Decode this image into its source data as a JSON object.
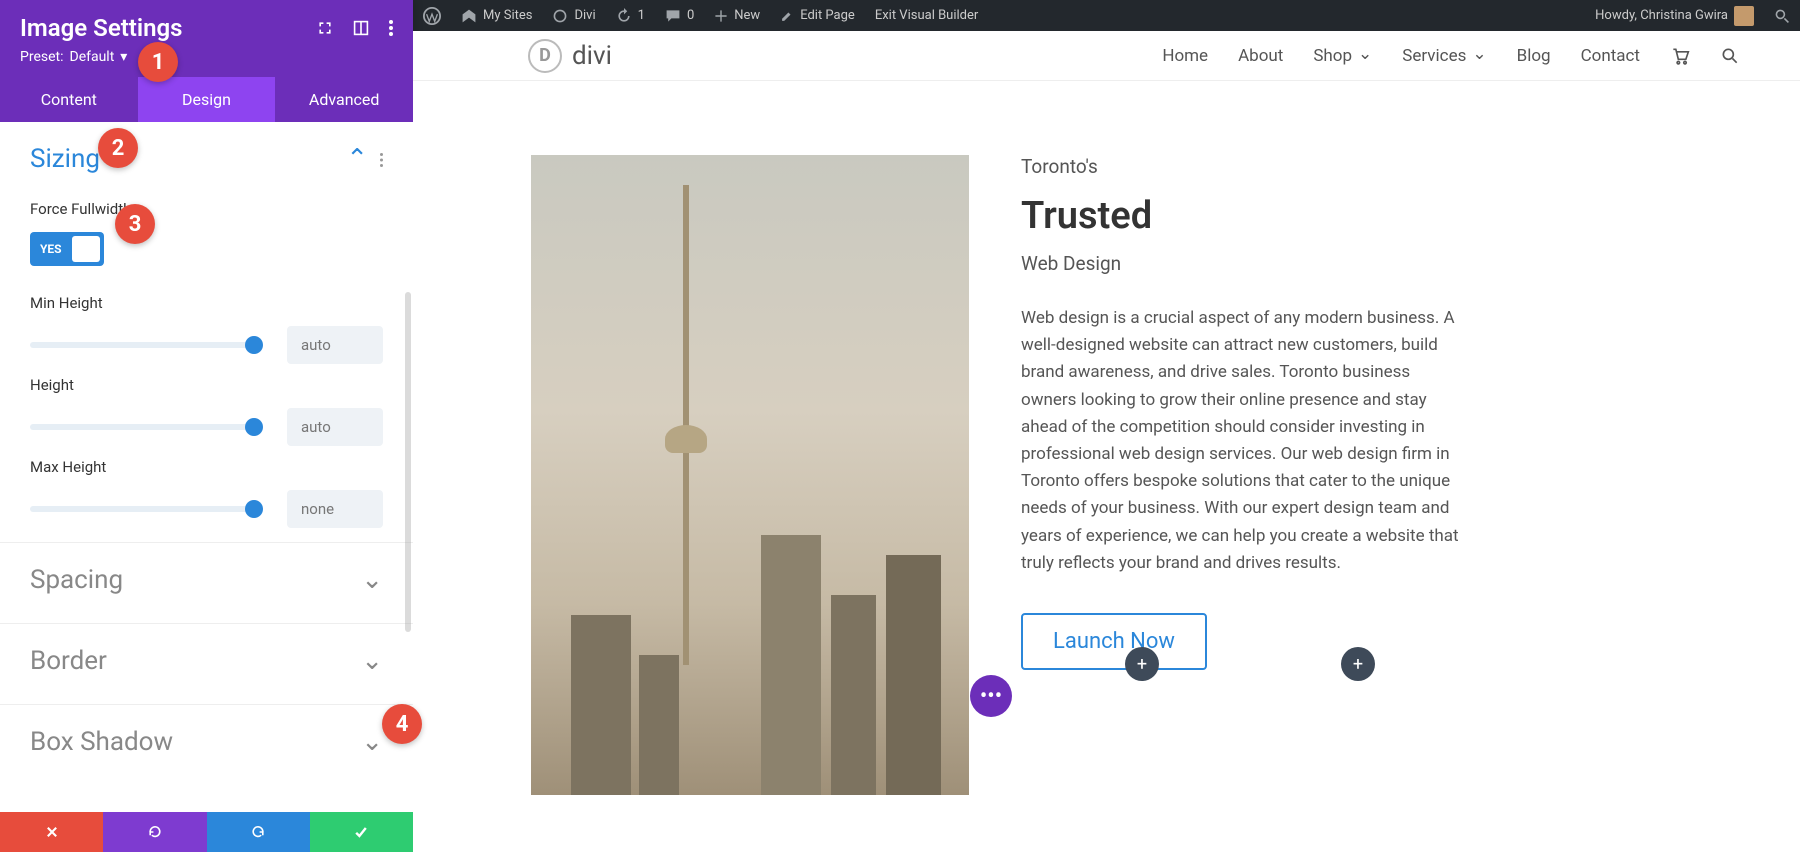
{
  "adminbar": {
    "my_sites": "My Sites",
    "site_name": "Divi",
    "updates": "1",
    "comments": "0",
    "new": "New",
    "edit_page": "Edit Page",
    "exit_vb": "Exit Visual Builder",
    "howdy": "Howdy, Christina Gwira"
  },
  "panel": {
    "title": "Image Settings",
    "preset_label": "Preset:",
    "preset_value": "Default",
    "tabs": {
      "content": "Content",
      "design": "Design",
      "advanced": "Advanced"
    },
    "sections": {
      "sizing": "Sizing",
      "spacing": "Spacing",
      "border": "Border",
      "box_shadow": "Box Shadow"
    },
    "options": {
      "force_fullwidth": "Force Fullwidth",
      "toggle_yes": "YES",
      "min_height": "Min Height",
      "height": "Height",
      "max_height": "Max Height"
    },
    "values": {
      "min_height": "auto",
      "height": "auto",
      "max_height": "none"
    }
  },
  "site": {
    "brand": "divi",
    "nav": {
      "home": "Home",
      "about": "About",
      "shop": "Shop",
      "services": "Services",
      "blog": "Blog",
      "contact": "Contact"
    },
    "hero": {
      "sup": "Toronto's",
      "title": "Trusted",
      "sub": "Web Design",
      "body": "Web design is a crucial aspect of any modern business. A well-designed website can attract new customers, build brand awareness, and drive sales. Toronto business owners looking to grow their online presence and stay ahead of the competition should consider investing in professional web design services. Our web design firm in Toronto offers bespoke solutions that cater to the unique needs of your business. With our expert design team and years of experience, we can help you create a website that truly reflects your brand and drives results.",
      "cta": "Launch Now"
    }
  },
  "badges": {
    "b1": "1",
    "b2": "2",
    "b3": "3",
    "b4": "4"
  }
}
